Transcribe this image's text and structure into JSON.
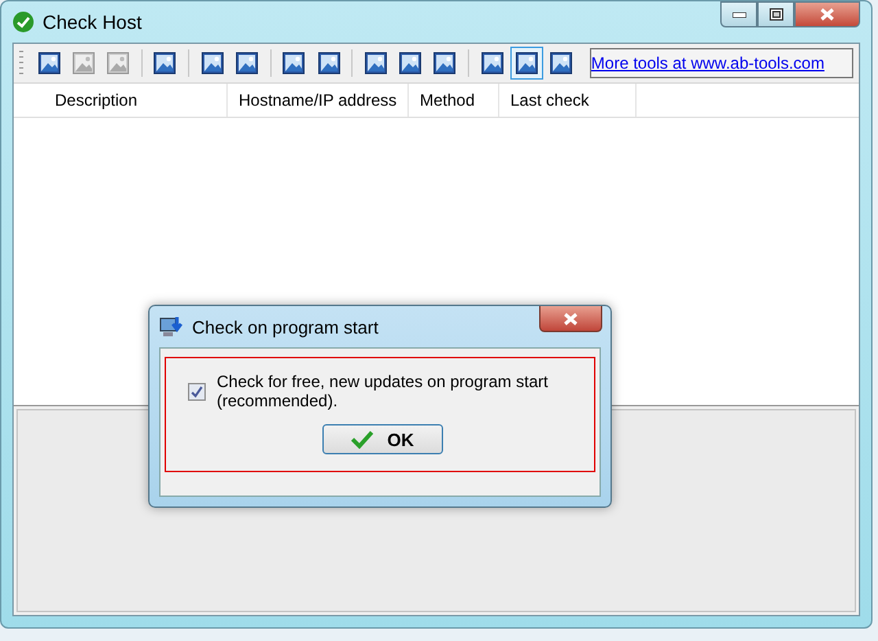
{
  "window": {
    "title": "Check Host"
  },
  "toolbar": {
    "groups": [
      {
        "buttons": [
          {
            "disabled": false,
            "selected": false
          },
          {
            "disabled": true,
            "selected": false
          },
          {
            "disabled": true,
            "selected": false
          }
        ]
      },
      {
        "buttons": [
          {
            "disabled": false,
            "selected": false
          }
        ]
      },
      {
        "buttons": [
          {
            "disabled": false,
            "selected": false
          },
          {
            "disabled": false,
            "selected": false
          }
        ]
      },
      {
        "buttons": [
          {
            "disabled": false,
            "selected": false
          },
          {
            "disabled": false,
            "selected": false
          }
        ]
      },
      {
        "buttons": [
          {
            "disabled": false,
            "selected": false
          },
          {
            "disabled": false,
            "selected": false
          },
          {
            "disabled": false,
            "selected": false
          }
        ]
      },
      {
        "buttons": [
          {
            "disabled": false,
            "selected": false
          },
          {
            "disabled": false,
            "selected": true
          },
          {
            "disabled": false,
            "selected": false
          }
        ]
      }
    ],
    "link": "More tools at www.ab-tools.com"
  },
  "table": {
    "columns": [
      "Description",
      "Hostname/IP address",
      "Method",
      "Last check"
    ]
  },
  "dialog": {
    "title": "Check on program start",
    "checkbox": {
      "label": "Check for free, new updates on program start (recommended).",
      "checked": true
    },
    "button": "OK"
  }
}
